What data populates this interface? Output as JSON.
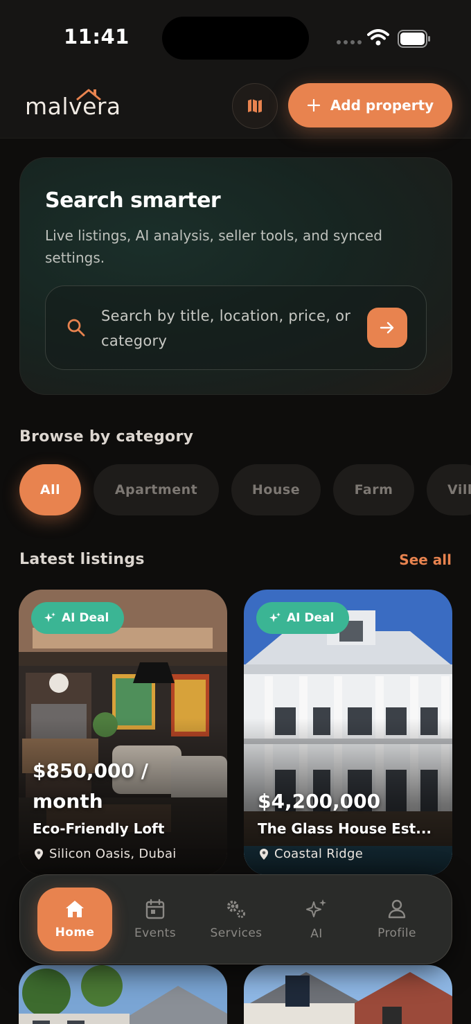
{
  "status_bar": {
    "time": "11:41"
  },
  "header": {
    "logo": "malvera",
    "add_property_label": "Add property",
    "icons": {
      "map": "map-icon",
      "add": "plus-icon"
    }
  },
  "hero": {
    "title": "Search smarter",
    "subtitle": "Live listings, AI analysis, seller tools, and synced settings.",
    "search_placeholder": "Search by title, location, price, or category"
  },
  "categories": {
    "title": "Browse by category",
    "items": [
      "All",
      "Apartment",
      "House",
      "Farm",
      "Vill"
    ],
    "active": "All"
  },
  "listings": {
    "title": "Latest listings",
    "see_all": "See all",
    "items": [
      {
        "badge": "AI Deal",
        "price_line1": "$850,000 /",
        "price_line2": "month",
        "title": "Eco-Friendly Loft",
        "location": "Silicon Oasis, Dubai"
      },
      {
        "badge": "AI Deal",
        "price_line1": "$4,200,000",
        "title": "The Glass House Est...",
        "location": "Coastal Ridge"
      }
    ]
  },
  "bottom_nav": {
    "items": [
      {
        "label": "Home",
        "icon": "home-icon"
      },
      {
        "label": "Events",
        "icon": "calendar-icon"
      },
      {
        "label": "Services",
        "icon": "gears-icon"
      },
      {
        "label": "AI",
        "icon": "sparkles-icon"
      },
      {
        "label": "Profile",
        "icon": "user-icon"
      }
    ],
    "active": "Home"
  },
  "colors": {
    "accent": "#e8834f",
    "badge": "#3bb594",
    "background": "#0e0d0c"
  }
}
